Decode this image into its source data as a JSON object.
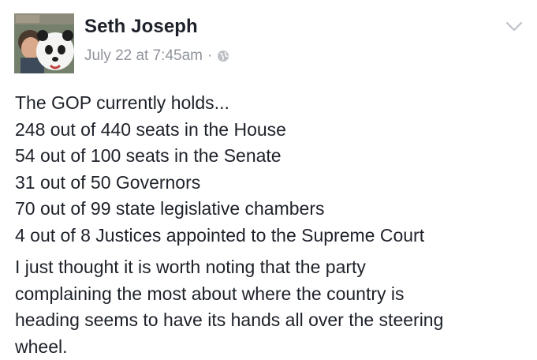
{
  "post": {
    "author": "Seth Joseph",
    "timestamp": "July 22 at 7:45am",
    "separator": "·",
    "privacy_icon": "globe-icon",
    "menu_icon": "chevron-down-icon",
    "lines": [
      "The GOP currently holds...",
      "248 out of 440 seats in the House",
      "54 out of 100 seats in the Senate",
      "31 out of 50 Governors",
      "70 out of 99 state legislative chambers",
      "4 out of 8 Justices appointed to the Supreme Court"
    ],
    "paragraph2_lines": [
      "I just thought it is worth noting that the party",
      "complaining the most about where the country is",
      "heading seems to have its hands all over the steering",
      "wheel."
    ]
  },
  "colors": {
    "text": "#1d2129",
    "meta": "#90949c",
    "background": "#ffffff"
  }
}
